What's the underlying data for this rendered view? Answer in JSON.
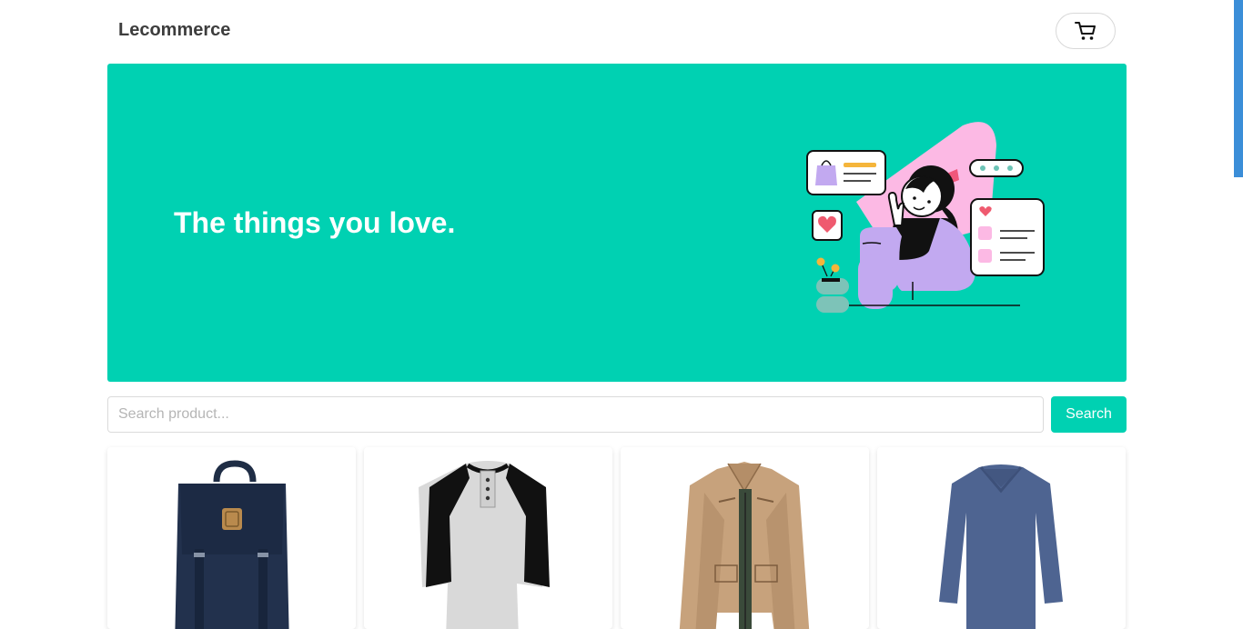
{
  "header": {
    "brand": "Lecommerce",
    "cart_icon": "cart-icon"
  },
  "hero": {
    "title": "The things you love.",
    "background_color": "#00d1b2",
    "illustration": "woman-shopping-illustration"
  },
  "search": {
    "placeholder": "Search product...",
    "value": "",
    "button_label": "Search"
  },
  "products": [
    {
      "image": "backpack-image"
    },
    {
      "image": "raglan-henley-shirt-image"
    },
    {
      "image": "khaki-jacket-image"
    },
    {
      "image": "blue-long-sleeve-shirt-image"
    }
  ]
}
